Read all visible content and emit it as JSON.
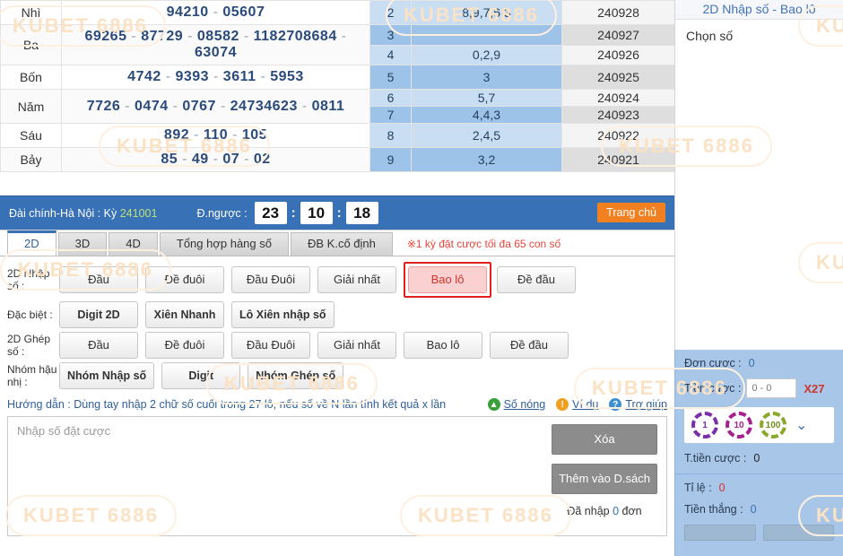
{
  "watermark": {
    "text": "KUBET 6886"
  },
  "results_table": {
    "rows": [
      {
        "label": "Nhì",
        "numbers": "94210 - 05607"
      },
      {
        "label": "Ba",
        "numbers": "69265 - 87729 - 08582 - 11827 08684 - 63074"
      },
      {
        "label": "Bốn",
        "numbers": "4742 - 9393 - 3611 - 5953"
      },
      {
        "label": "Năm",
        "numbers": "7726 - 0474 - 0767 - 2473 4623 - 0811"
      },
      {
        "label": "Sáu",
        "numbers": "892 - 110 - 105"
      },
      {
        "label": "Bảy",
        "numbers": "85 - 49 - 07 - 02"
      }
    ],
    "side_rows": [
      {
        "index": "2",
        "value": "8,9,7,6,3",
        "period": "240928"
      },
      {
        "index": "3",
        "value": "",
        "period": "240927"
      },
      {
        "index": "4",
        "value": "0,2,9",
        "period": "240926"
      },
      {
        "index": "5",
        "value": "3",
        "period": "240925"
      },
      {
        "index": "6",
        "value": "5,7",
        "period": "240924"
      },
      {
        "index": "7",
        "value": "4,4,3",
        "period": "240923"
      },
      {
        "index": "8",
        "value": "2,4,5",
        "period": "240922"
      },
      {
        "index": "9",
        "value": "3,2",
        "period": "240921"
      }
    ]
  },
  "right_top": {
    "title": "2D Nhập số - Bao lô",
    "subtitle": "Chọn số"
  },
  "statusbar": {
    "station_label": "Đài chính-Hà Nội",
    "separator": ":",
    "period_label": "Kỳ",
    "period_value": "241001",
    "countdown_label": "Đ.ngược :",
    "hours": "23",
    "minutes": "10",
    "seconds": "18",
    "colon": ":",
    "home_button": "Trang chủ"
  },
  "tabs": {
    "items": [
      {
        "label": "2D",
        "active": true
      },
      {
        "label": "3D",
        "active": false
      },
      {
        "label": "4D",
        "active": false
      },
      {
        "label": "Tổng hợp hàng số",
        "active": false
      },
      {
        "label": "ĐB K.cố định",
        "active": false
      }
    ],
    "note": "※1 kỳ đặt cược tối đa 65 con số"
  },
  "bet_groups": [
    {
      "label": "2D Nhập số :",
      "buttons": [
        {
          "label": "Đầu",
          "selected": false
        },
        {
          "label": "Đề đuôi",
          "selected": false
        },
        {
          "label": "Đầu Đuôi",
          "selected": false
        },
        {
          "label": "Giải nhất",
          "selected": false
        },
        {
          "label": "Bao lô",
          "selected": true
        },
        {
          "label": "Đề đầu",
          "selected": false
        }
      ]
    },
    {
      "label": "Đặc biệt :",
      "buttons": [
        {
          "label": "Digit 2D",
          "selected": false,
          "bold": true
        },
        {
          "label": "Xiên Nhanh",
          "selected": false,
          "bold": true
        },
        {
          "label": "Lô Xiên nhập số",
          "selected": false,
          "bold": true
        }
      ]
    },
    {
      "label": "2D Ghép số :",
      "buttons": [
        {
          "label": "Đầu",
          "selected": false
        },
        {
          "label": "Đề đuôi",
          "selected": false
        },
        {
          "label": "Đầu Đuôi",
          "selected": false
        },
        {
          "label": "Giải nhất",
          "selected": false
        },
        {
          "label": "Bao lô",
          "selected": false
        },
        {
          "label": "Đề đầu",
          "selected": false
        }
      ]
    },
    {
      "label": "Nhóm hậu nhị :",
      "buttons": [
        {
          "label": "Nhóm Nhập số",
          "selected": false,
          "bold": true
        },
        {
          "label": "Digit",
          "selected": false,
          "bold": true
        },
        {
          "label": "Nhóm Ghép số",
          "selected": false,
          "bold": true
        }
      ]
    }
  ],
  "hint": {
    "text": "Hướng dẫn : Dùng tay nhập 2 chữ số cuối trong 27 lô, nếu số về N lần tính kết quả x lần",
    "links": [
      {
        "label": "Số nóng",
        "icon": "arrow-up-circle-icon",
        "glyph": "▲",
        "color": "#3aa03a"
      },
      {
        "label": "Ví dụ",
        "icon": "exclamation-circle-icon",
        "glyph": "!",
        "color": "#f0a020"
      },
      {
        "label": "Trợ giúp",
        "icon": "question-circle-icon",
        "glyph": "?",
        "color": "#3f8fd0"
      }
    ]
  },
  "input_area": {
    "placeholder": "Nhập số đặt cược",
    "value": "",
    "clear_button": "Xóa",
    "add_button": "Thêm vào D.sách",
    "count_prefix": "Đã nhập",
    "count_value": "0",
    "count_suffix": "đơn"
  },
  "bet_panel": {
    "order_label": "Đơn cược :",
    "order_value": "0",
    "stake_label": "Tiền cược :",
    "stake_placeholder": "0 - 0",
    "stake_value": "",
    "multiplier": "X27",
    "chips": [
      {
        "value": "1",
        "color": "#7a2ea8"
      },
      {
        "value": "10",
        "color": "#a8208f"
      },
      {
        "value": "100",
        "color": "#8aa82a"
      }
    ],
    "chevron": "⌄",
    "total_label": "T.tiền cược :",
    "total_value": "0",
    "rate_label": "Tỉ lệ :",
    "rate_value": "0",
    "win_label": "Tiền thắng :",
    "win_value": "0"
  }
}
